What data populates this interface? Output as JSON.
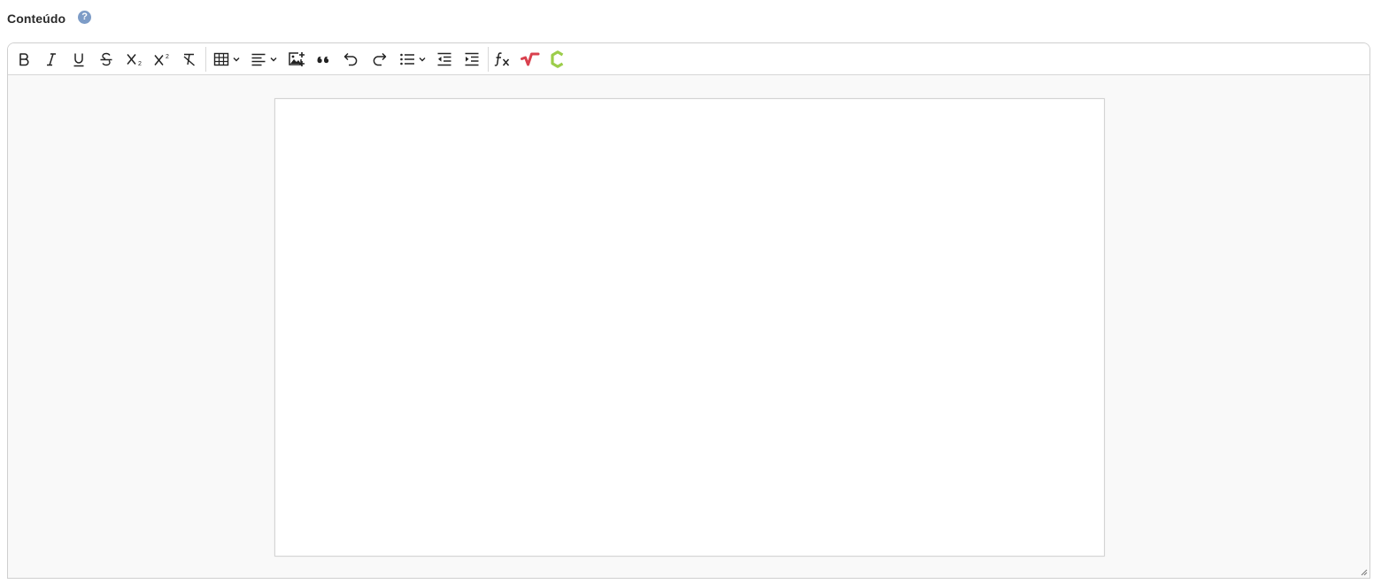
{
  "field": {
    "label": "Conteúdo",
    "help_glyph": "?"
  },
  "toolbar": {
    "items": [
      {
        "name": "bold-button",
        "icon": "bold-icon"
      },
      {
        "name": "italic-button",
        "icon": "italic-icon"
      },
      {
        "name": "underline-button",
        "icon": "underline-icon"
      },
      {
        "name": "strikethrough-button",
        "icon": "strikethrough-icon"
      },
      {
        "name": "subscript-button",
        "icon": "subscript-icon"
      },
      {
        "name": "superscript-button",
        "icon": "superscript-icon"
      },
      {
        "name": "remove-format-button",
        "icon": "remove-format-icon"
      },
      {
        "name": "insert-table-dropdown",
        "icon": "table-icon"
      },
      {
        "name": "text-align-dropdown",
        "icon": "align-left-icon"
      },
      {
        "name": "insert-image-button",
        "icon": "image-add-icon"
      },
      {
        "name": "blockquote-button",
        "icon": "quote-icon"
      },
      {
        "name": "undo-button",
        "icon": "undo-icon"
      },
      {
        "name": "redo-button",
        "icon": "redo-icon"
      },
      {
        "name": "bulleted-list-dropdown",
        "icon": "bulleted-list-icon"
      },
      {
        "name": "outdent-button",
        "icon": "outdent-icon"
      },
      {
        "name": "indent-button",
        "icon": "indent-icon"
      },
      {
        "name": "math-formula-button",
        "icon": "function-icon"
      },
      {
        "name": "mathtype-button",
        "icon": "mathtype-icon"
      },
      {
        "name": "chemtype-button",
        "icon": "chemtype-icon"
      }
    ]
  },
  "colors": {
    "help_icon": "#7d9cc7",
    "mathtype_red": "#d9414e",
    "chemtype_green": "#9ccd4a",
    "editor_background": "#f9f9f9",
    "page_background": "#ffffff"
  },
  "editor": {
    "content": ""
  }
}
